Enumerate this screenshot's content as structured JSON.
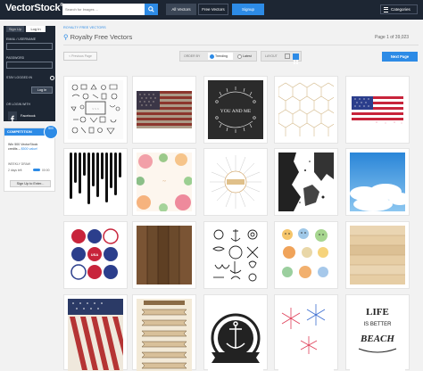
{
  "header": {
    "logo": "VectorStock",
    "logo_mark": "®",
    "search_placeholder": "Search for Images ...",
    "nav_all": "All Vectors",
    "nav_free": "Free Vectors",
    "nav_signup": "Signup",
    "categories": "Categories"
  },
  "sidebar": {
    "tab_signup": "Sign Up",
    "tab_login": "Log In",
    "email_label": "EMAIL / USERNAME",
    "password_label": "PASSWORD",
    "stay_label": "STAY LOGGED IN",
    "login_button": "Log In",
    "or_login": "OR LOGIN WITH",
    "facebook": "Facebook"
  },
  "competition": {
    "heading": "COMPETITION",
    "badge": "500",
    "text_prefix": "Win 500 VectorStock credits – ",
    "text_highlight": "$500 value!",
    "weekly": "WEEKLY DRAW",
    "days_left": "2 days left",
    "time": "00:00",
    "button": "Sign Up to Enter..."
  },
  "main": {
    "breadcrumb": "ROYALTY FREE VECTORS",
    "title": "Royalty Free Vectors",
    "page_info": "Page 1 of 39,023",
    "prev": "< Previous Page",
    "order_label": "ORDER BY",
    "order_trending": "Trending",
    "order_latest": "Latest",
    "layout_label": "LAYOUT",
    "next": "Next Page"
  },
  "colors": {
    "topbar": "#1d2633",
    "accent": "#2d8be6"
  },
  "thumbnails": [
    {
      "name": "doodle-icons"
    },
    {
      "name": "grunge-american-flag"
    },
    {
      "name": "chalkboard-wreath"
    },
    {
      "name": "hexagon-pattern"
    },
    {
      "name": "glitter-american-flag"
    },
    {
      "name": "halftone-drips"
    },
    {
      "name": "watercolor-flowers"
    },
    {
      "name": "sunburst-labels"
    },
    {
      "name": "grunge-texture"
    },
    {
      "name": "sky-clouds"
    },
    {
      "name": "american-badges"
    },
    {
      "name": "wood-planks-dark"
    },
    {
      "name": "nautical-set"
    },
    {
      "name": "cartoon-animals"
    },
    {
      "name": "wood-planks-light"
    },
    {
      "name": "vintage-flag-stripes"
    },
    {
      "name": "ribbon-banners"
    },
    {
      "name": "anchor-emblem"
    },
    {
      "name": "fireworks"
    },
    {
      "name": "beach-lettering"
    }
  ],
  "thumb_texts": {
    "you_and_me": "YOU AND ME",
    "lettering_line1": "LIFE",
    "lettering_line2": "IS BETTER",
    "lettering_line3": "BEACH",
    "usa": "USA"
  }
}
